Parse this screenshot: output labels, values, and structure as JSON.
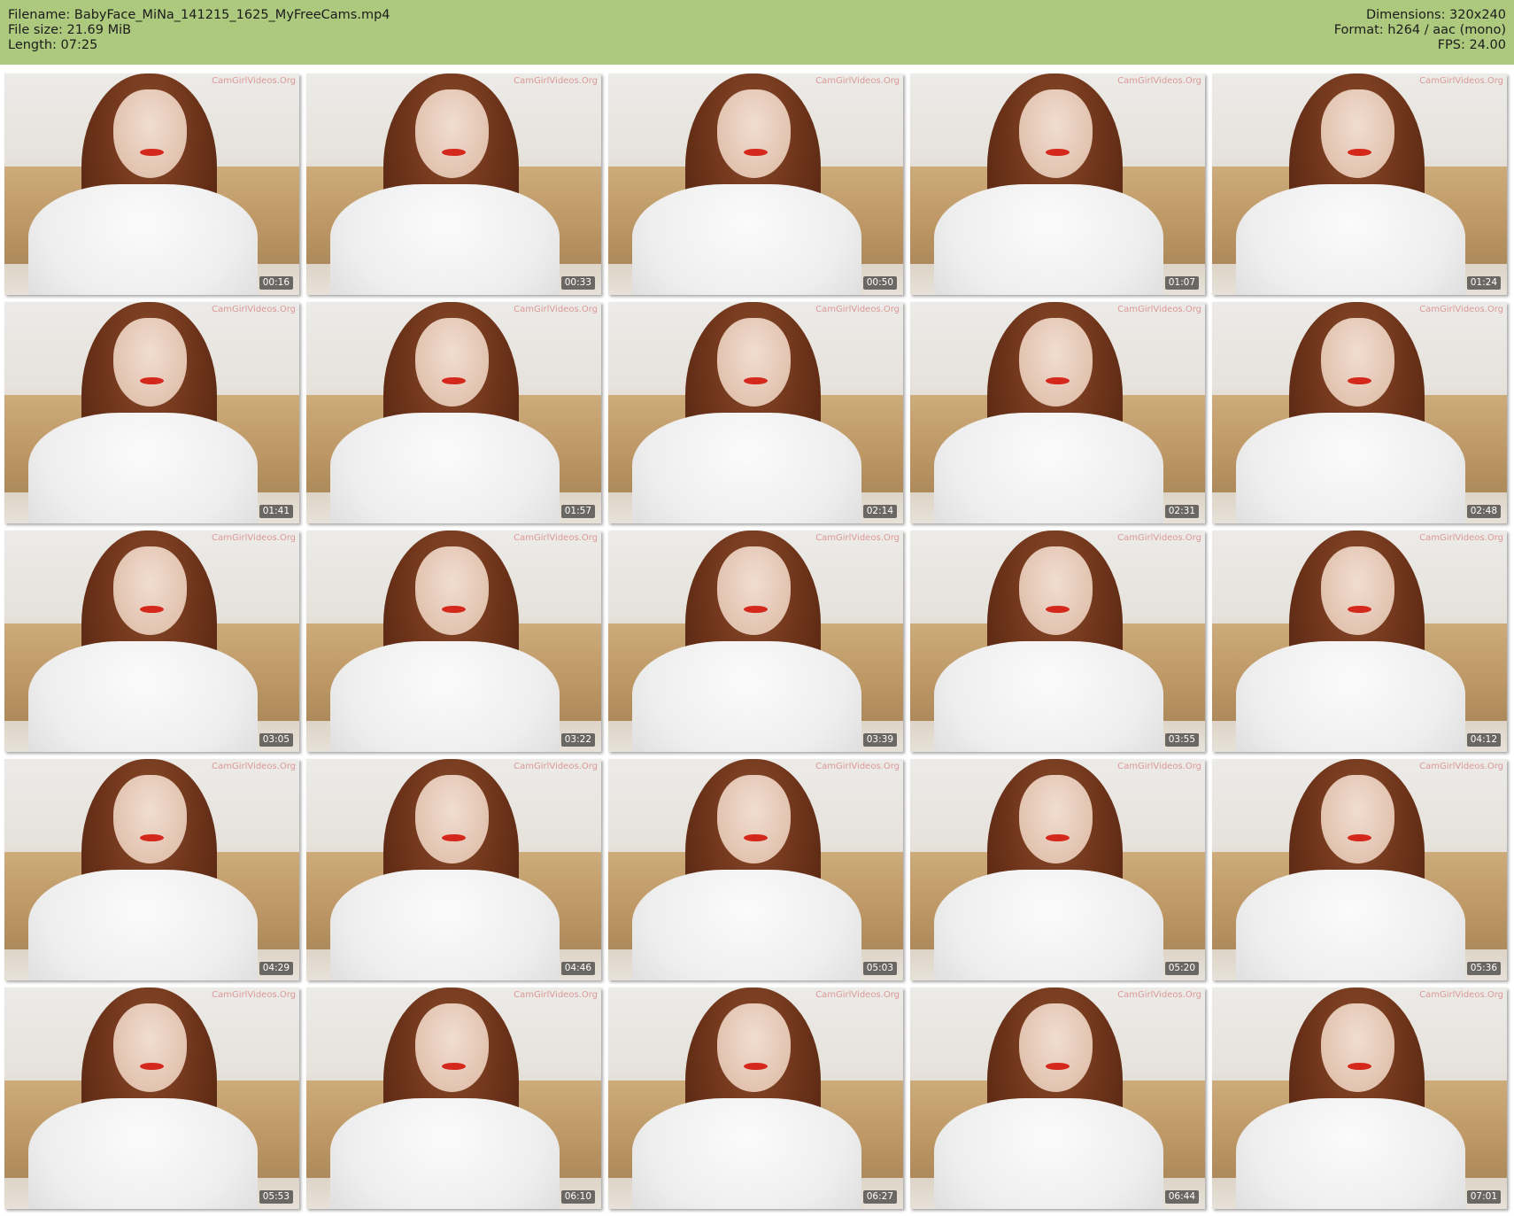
{
  "header": {
    "filename_line": "Filename: BabyFace_MiNa_141215_1625_MyFreeCams.mp4",
    "filesize_line": "File size: 21.69 MiB",
    "length_line": "Length: 07:25",
    "dimensions_line": "Dimensions: 320x240",
    "format_line": "Format: h264 / aac (mono)",
    "fps_line": "FPS: 24.00",
    "background_color": "#acc97d"
  },
  "thumbnails": [
    {
      "timestamp": "00:16"
    },
    {
      "timestamp": "00:33"
    },
    {
      "timestamp": "00:50"
    },
    {
      "timestamp": "01:07"
    },
    {
      "timestamp": "01:24"
    },
    {
      "timestamp": "01:41"
    },
    {
      "timestamp": "01:57"
    },
    {
      "timestamp": "02:14"
    },
    {
      "timestamp": "02:31"
    },
    {
      "timestamp": "02:48"
    },
    {
      "timestamp": "03:05"
    },
    {
      "timestamp": "03:22"
    },
    {
      "timestamp": "03:39"
    },
    {
      "timestamp": "03:55"
    },
    {
      "timestamp": "04:12"
    },
    {
      "timestamp": "04:29"
    },
    {
      "timestamp": "04:46"
    },
    {
      "timestamp": "05:03"
    },
    {
      "timestamp": "05:20"
    },
    {
      "timestamp": "05:36"
    },
    {
      "timestamp": "05:53"
    },
    {
      "timestamp": "06:10"
    },
    {
      "timestamp": "06:27"
    },
    {
      "timestamp": "06:44"
    },
    {
      "timestamp": "07:01"
    }
  ],
  "watermark": "CamGirlVideos.Org"
}
